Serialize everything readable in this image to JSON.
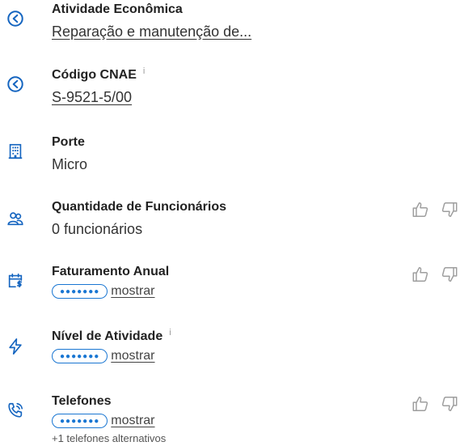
{
  "fields": {
    "activity": {
      "label": "Atividade Econômica",
      "value": "Reparação e manutenção de..."
    },
    "cnae": {
      "label": "Código CNAE",
      "info": "i",
      "value": "S-9521-5/00"
    },
    "size": {
      "label": "Porte",
      "value": "Micro"
    },
    "employees": {
      "label": "Quantidade de Funcionários",
      "value": "0 funcionários"
    },
    "revenue": {
      "label": "Faturamento Anual",
      "masked": "●●●●●●●",
      "show": "mostrar"
    },
    "activity_level": {
      "label": "Nível de Atividade",
      "info": "i",
      "masked": "●●●●●●●",
      "show": "mostrar"
    },
    "phones": {
      "label": "Telefones",
      "masked": "●●●●●●●",
      "show": "mostrar",
      "alt": "+1 telefones alternativos"
    }
  },
  "colors": {
    "accent": "#1976d2",
    "icon": "#1565c0",
    "vote": "#9e9e9e"
  },
  "icons": [
    "clock-back-icon",
    "building-icon",
    "people-icon",
    "calendar-money-icon",
    "lightning-icon",
    "phone-ring-icon",
    "thumbs-up-icon",
    "thumbs-down-icon"
  ]
}
